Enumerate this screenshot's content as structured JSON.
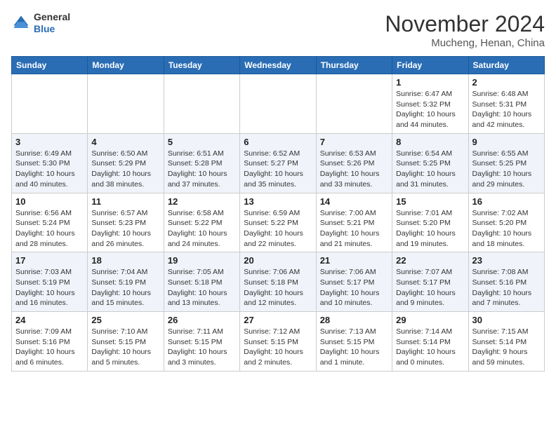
{
  "header": {
    "logo_general": "General",
    "logo_blue": "Blue",
    "month_title": "November 2024",
    "location": "Mucheng, Henan, China"
  },
  "weekdays": [
    "Sunday",
    "Monday",
    "Tuesday",
    "Wednesday",
    "Thursday",
    "Friday",
    "Saturday"
  ],
  "weeks": [
    {
      "days": [
        {
          "num": "",
          "info": ""
        },
        {
          "num": "",
          "info": ""
        },
        {
          "num": "",
          "info": ""
        },
        {
          "num": "",
          "info": ""
        },
        {
          "num": "",
          "info": ""
        },
        {
          "num": "1",
          "info": "Sunrise: 6:47 AM\nSunset: 5:32 PM\nDaylight: 10 hours\nand 44 minutes."
        },
        {
          "num": "2",
          "info": "Sunrise: 6:48 AM\nSunset: 5:31 PM\nDaylight: 10 hours\nand 42 minutes."
        }
      ]
    },
    {
      "days": [
        {
          "num": "3",
          "info": "Sunrise: 6:49 AM\nSunset: 5:30 PM\nDaylight: 10 hours\nand 40 minutes."
        },
        {
          "num": "4",
          "info": "Sunrise: 6:50 AM\nSunset: 5:29 PM\nDaylight: 10 hours\nand 38 minutes."
        },
        {
          "num": "5",
          "info": "Sunrise: 6:51 AM\nSunset: 5:28 PM\nDaylight: 10 hours\nand 37 minutes."
        },
        {
          "num": "6",
          "info": "Sunrise: 6:52 AM\nSunset: 5:27 PM\nDaylight: 10 hours\nand 35 minutes."
        },
        {
          "num": "7",
          "info": "Sunrise: 6:53 AM\nSunset: 5:26 PM\nDaylight: 10 hours\nand 33 minutes."
        },
        {
          "num": "8",
          "info": "Sunrise: 6:54 AM\nSunset: 5:25 PM\nDaylight: 10 hours\nand 31 minutes."
        },
        {
          "num": "9",
          "info": "Sunrise: 6:55 AM\nSunset: 5:25 PM\nDaylight: 10 hours\nand 29 minutes."
        }
      ]
    },
    {
      "days": [
        {
          "num": "10",
          "info": "Sunrise: 6:56 AM\nSunset: 5:24 PM\nDaylight: 10 hours\nand 28 minutes."
        },
        {
          "num": "11",
          "info": "Sunrise: 6:57 AM\nSunset: 5:23 PM\nDaylight: 10 hours\nand 26 minutes."
        },
        {
          "num": "12",
          "info": "Sunrise: 6:58 AM\nSunset: 5:22 PM\nDaylight: 10 hours\nand 24 minutes."
        },
        {
          "num": "13",
          "info": "Sunrise: 6:59 AM\nSunset: 5:22 PM\nDaylight: 10 hours\nand 22 minutes."
        },
        {
          "num": "14",
          "info": "Sunrise: 7:00 AM\nSunset: 5:21 PM\nDaylight: 10 hours\nand 21 minutes."
        },
        {
          "num": "15",
          "info": "Sunrise: 7:01 AM\nSunset: 5:20 PM\nDaylight: 10 hours\nand 19 minutes."
        },
        {
          "num": "16",
          "info": "Sunrise: 7:02 AM\nSunset: 5:20 PM\nDaylight: 10 hours\nand 18 minutes."
        }
      ]
    },
    {
      "days": [
        {
          "num": "17",
          "info": "Sunrise: 7:03 AM\nSunset: 5:19 PM\nDaylight: 10 hours\nand 16 minutes."
        },
        {
          "num": "18",
          "info": "Sunrise: 7:04 AM\nSunset: 5:19 PM\nDaylight: 10 hours\nand 15 minutes."
        },
        {
          "num": "19",
          "info": "Sunrise: 7:05 AM\nSunset: 5:18 PM\nDaylight: 10 hours\nand 13 minutes."
        },
        {
          "num": "20",
          "info": "Sunrise: 7:06 AM\nSunset: 5:18 PM\nDaylight: 10 hours\nand 12 minutes."
        },
        {
          "num": "21",
          "info": "Sunrise: 7:06 AM\nSunset: 5:17 PM\nDaylight: 10 hours\nand 10 minutes."
        },
        {
          "num": "22",
          "info": "Sunrise: 7:07 AM\nSunset: 5:17 PM\nDaylight: 10 hours\nand 9 minutes."
        },
        {
          "num": "23",
          "info": "Sunrise: 7:08 AM\nSunset: 5:16 PM\nDaylight: 10 hours\nand 7 minutes."
        }
      ]
    },
    {
      "days": [
        {
          "num": "24",
          "info": "Sunrise: 7:09 AM\nSunset: 5:16 PM\nDaylight: 10 hours\nand 6 minutes."
        },
        {
          "num": "25",
          "info": "Sunrise: 7:10 AM\nSunset: 5:15 PM\nDaylight: 10 hours\nand 5 minutes."
        },
        {
          "num": "26",
          "info": "Sunrise: 7:11 AM\nSunset: 5:15 PM\nDaylight: 10 hours\nand 3 minutes."
        },
        {
          "num": "27",
          "info": "Sunrise: 7:12 AM\nSunset: 5:15 PM\nDaylight: 10 hours\nand 2 minutes."
        },
        {
          "num": "28",
          "info": "Sunrise: 7:13 AM\nSunset: 5:15 PM\nDaylight: 10 hours\nand 1 minute."
        },
        {
          "num": "29",
          "info": "Sunrise: 7:14 AM\nSunset: 5:14 PM\nDaylight: 10 hours\nand 0 minutes."
        },
        {
          "num": "30",
          "info": "Sunrise: 7:15 AM\nSunset: 5:14 PM\nDaylight: 9 hours\nand 59 minutes."
        }
      ]
    }
  ]
}
